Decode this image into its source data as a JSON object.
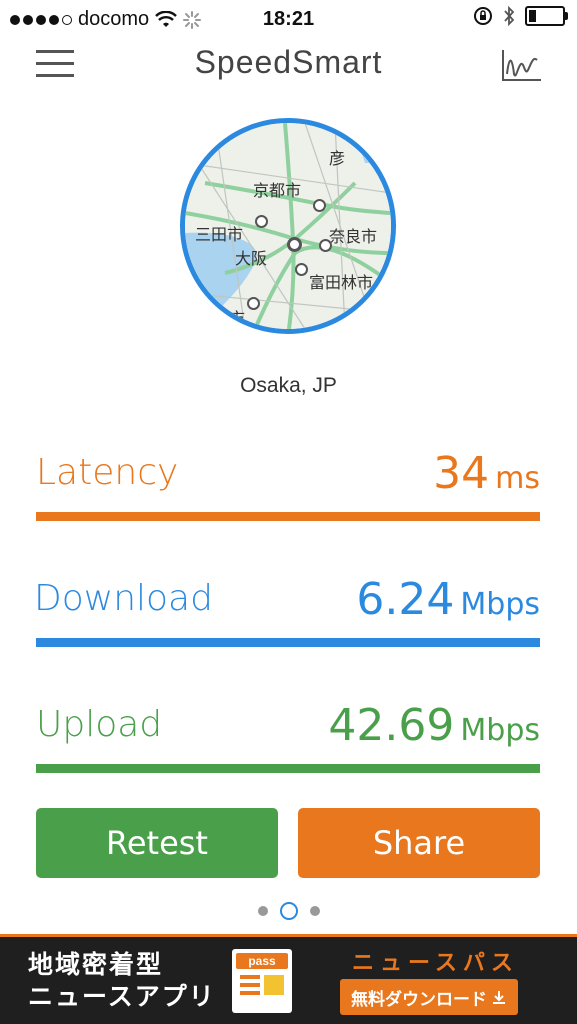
{
  "status_bar": {
    "carrier": "docomo",
    "time": "18:21",
    "battery_level": 0.25
  },
  "header": {
    "title": "SpeedSmart",
    "menu_icon": "hamburger-menu-icon",
    "history_icon": "graph-icon"
  },
  "map": {
    "labels": [
      "彦",
      "京都市",
      "三田市",
      "大阪",
      "奈良市",
      "富田林市",
      "市"
    ]
  },
  "location": "Osaka, JP",
  "metrics": {
    "latency": {
      "label": "Latency",
      "value": "34",
      "unit": "ms",
      "color": "#e8771d"
    },
    "download": {
      "label": "Download",
      "value": "6.24",
      "unit": "Mbps",
      "color": "#2b8ae0"
    },
    "upload": {
      "label": "Upload",
      "value": "42.69",
      "unit": "Mbps",
      "color": "#4aa04a"
    }
  },
  "buttons": {
    "retest": "Retest",
    "share": "Share",
    "retest_color": "#4aa04a",
    "share_color": "#e8771d"
  },
  "pager": {
    "current_page": 2,
    "total_pages": 3
  },
  "ad": {
    "left_line1": "地域密着型",
    "left_line2": "ニュースアプリ",
    "logo_text": "pass",
    "right_title": "ニュースパス",
    "cta": "無料ダウンロード"
  }
}
